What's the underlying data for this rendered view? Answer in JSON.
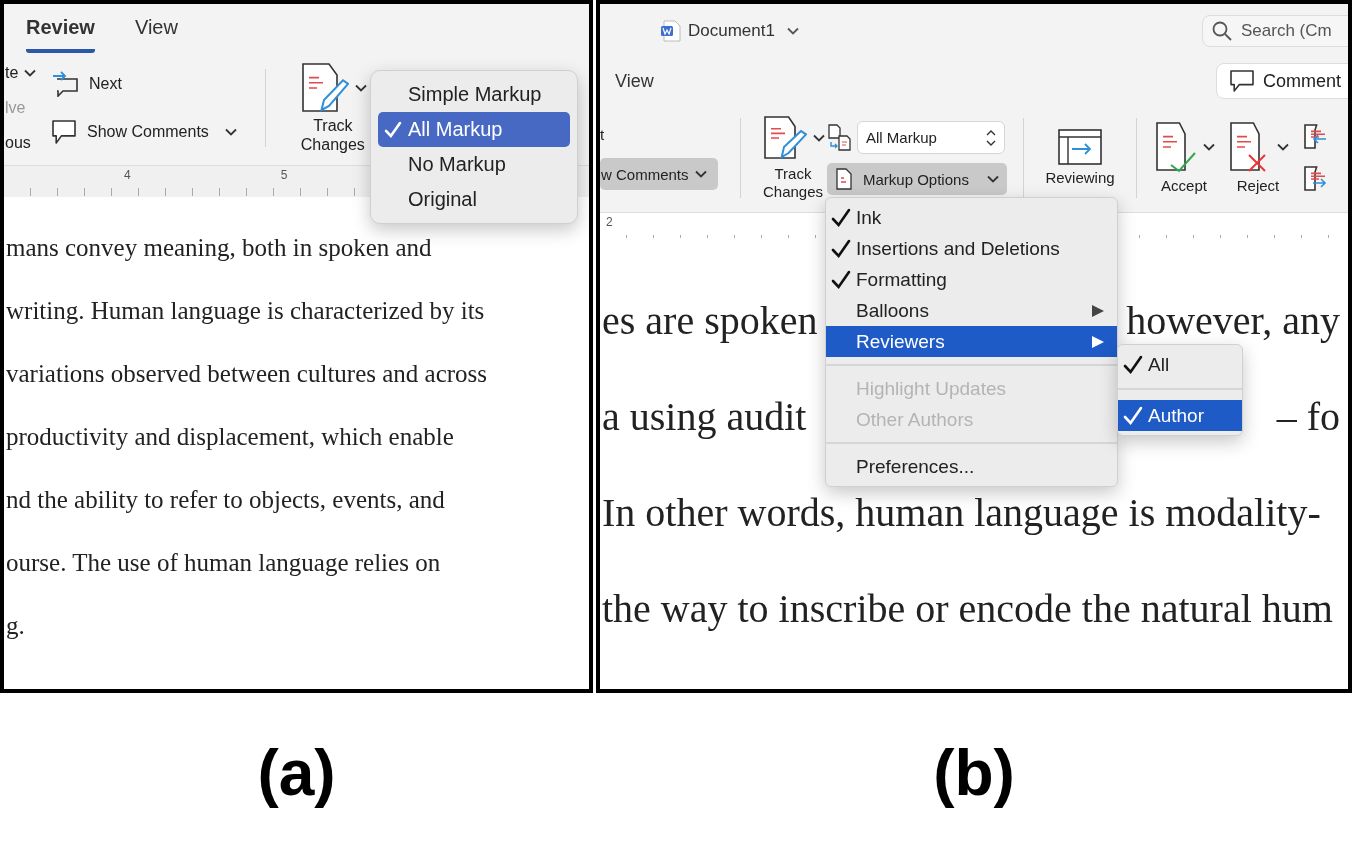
{
  "panel_a": {
    "caption": "(a)",
    "tabs": [
      {
        "label": "Review",
        "selected": true
      },
      {
        "label": "View",
        "selected": false
      }
    ],
    "ribbon": {
      "cut_labels": [
        {
          "text": "te",
          "disabled": false,
          "chevron": true
        },
        {
          "text": "lve",
          "disabled": true,
          "chevron": false
        },
        {
          "text": "ous",
          "disabled": false,
          "chevron": false
        }
      ],
      "next": "Next",
      "show_comments": "Show Comments",
      "track_changes": "Track Changes"
    },
    "ruler_numbers": [
      "4",
      "5"
    ],
    "markup_menu": [
      {
        "label": "Simple Markup",
        "selected": false
      },
      {
        "label": "All Markup",
        "selected": true
      },
      {
        "label": "No Markup",
        "selected": false
      },
      {
        "label": "Original",
        "selected": false
      }
    ],
    "body_lines": [
      "mans convey meaning, both in spoken and",
      "writing. Human language is characterized by its",
      "variations observed between cultures and across",
      "productivity and displacement, which enable",
      "nd the ability to refer to objects, events, and",
      "ourse. The use of human language relies on",
      "g."
    ]
  },
  "panel_b": {
    "caption": "(b)",
    "document_title": "Document1",
    "search": {
      "placeholder": "Search (Cm"
    },
    "tabs": [
      {
        "label": "View",
        "selected": false
      }
    ],
    "comments_button": "Comment",
    "ribbon": {
      "cut_label": "t",
      "show_comments": "w Comments",
      "track_changes": "Track Changes",
      "markup_select": "All Markup",
      "markup_options": "Markup Options",
      "reviewing": "Reviewing",
      "accept": "Accept",
      "reject": "Reject"
    },
    "ruler_numbers": [
      "2"
    ],
    "markup_options_menu": [
      {
        "kind": "item",
        "label": "Ink",
        "checked": true,
        "disabled": false,
        "selected": false
      },
      {
        "kind": "item",
        "label": "Insertions and Deletions",
        "checked": true,
        "disabled": false,
        "selected": false
      },
      {
        "kind": "item",
        "label": "Formatting",
        "checked": true,
        "disabled": false,
        "selected": false
      },
      {
        "kind": "submenu",
        "label": "Balloons",
        "checked": false,
        "disabled": false,
        "selected": false
      },
      {
        "kind": "submenu",
        "label": "Reviewers",
        "checked": false,
        "disabled": false,
        "selected": true
      },
      {
        "kind": "separator"
      },
      {
        "kind": "item",
        "label": "Highlight Updates",
        "checked": false,
        "disabled": true,
        "selected": false
      },
      {
        "kind": "item",
        "label": "Other Authors",
        "checked": false,
        "disabled": true,
        "selected": false
      },
      {
        "kind": "separator"
      },
      {
        "kind": "item",
        "label": "Preferences...",
        "checked": false,
        "disabled": false,
        "selected": false
      }
    ],
    "reviewers_submenu": [
      {
        "kind": "item",
        "label": "All",
        "checked": true,
        "disabled": false,
        "selected": false
      },
      {
        "kind": "separator"
      },
      {
        "kind": "item",
        "label": "Author",
        "checked": true,
        "disabled": false,
        "selected": true
      }
    ],
    "body_lines": [
      [
        "es are spoken",
        "however, any"
      ],
      [
        "a using audit",
        "– fo"
      ],
      [
        "In other words, human language is modality-"
      ],
      [
        "the way to inscribe or encode the natural hum"
      ]
    ]
  }
}
